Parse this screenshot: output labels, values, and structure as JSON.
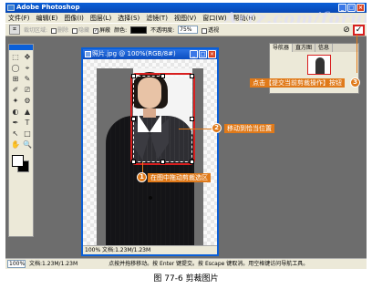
{
  "app": {
    "title": "Adobe Photoshop",
    "minimize": "_",
    "maximize": "□",
    "close": "×"
  },
  "watermark": "Artz.com/forum",
  "menu": [
    "文件(F)",
    "编辑(E)",
    "图像(I)",
    "图层(L)",
    "选择(S)",
    "滤镜(T)",
    "视图(V)",
    "窗口(W)",
    "帮助(H)"
  ],
  "options": {
    "crop_area_label": "裁切区域:",
    "delete_label": "删除",
    "hide_label": "隐藏",
    "shield_label": "屏蔽",
    "color_label": "颜色:",
    "opacity_label": "不透明度:",
    "opacity_value": "75%",
    "perspective_label": "透视",
    "cancel_symbol": "⊘",
    "commit_symbol": "✓"
  },
  "tools": [
    "⬚",
    "✥",
    "◯",
    "⌖",
    "⊞",
    "✎",
    "✐",
    "⎚",
    "✦",
    "⚙",
    "◐",
    "▲",
    "✒",
    "T",
    "↖",
    "□",
    "✋",
    "🔍"
  ],
  "navigator": {
    "tabs": [
      "导航器",
      "直方图",
      "信息"
    ]
  },
  "document": {
    "title": "照片.jpg @ 100%(RGB/8#)",
    "status": "100%  文档:1.23M/1.23M"
  },
  "callouts": {
    "c1_number": "1",
    "c1_text": "在图中拖动剪裁选区",
    "c2_number": "2",
    "c2_text": "移动到恰当位置",
    "c3_number": "3",
    "c3_text": "点击【提交当前剪裁操作】按钮"
  },
  "statusbar": {
    "zoom": "100%",
    "doc_size": "文档:1.23M/1.23M",
    "hint": "点按并拖移移动。按 Enter 键提交。按 Escape 键取消。用空格键访问导航工具。"
  },
  "caption": "图 77-6   剪裁图片"
}
